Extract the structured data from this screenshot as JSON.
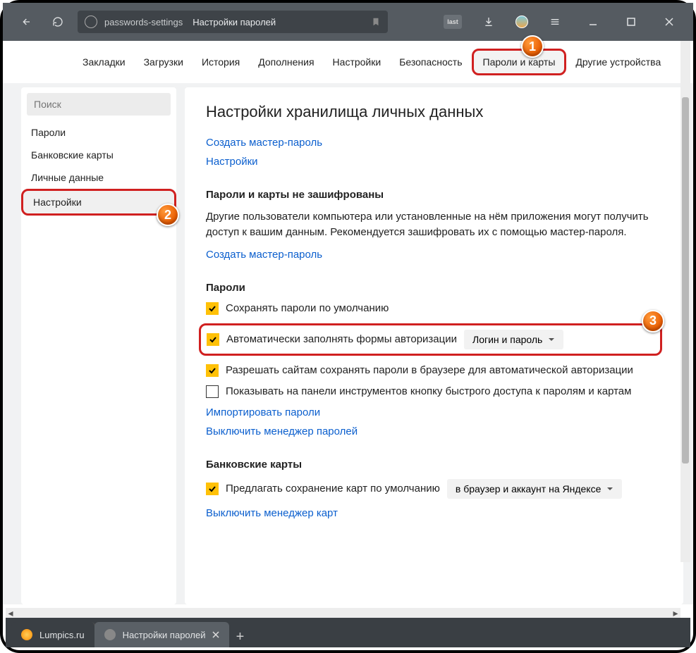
{
  "chrome": {
    "url_slug": "passwords-settings",
    "url_title": "Настройки паролей",
    "ext_badge": "last"
  },
  "topnav": {
    "items": [
      "Закладки",
      "Загрузки",
      "История",
      "Дополнения",
      "Настройки",
      "Безопасность",
      "Пароли и карты",
      "Другие устройства"
    ]
  },
  "sidebar": {
    "search_placeholder": "Поиск",
    "items": [
      "Пароли",
      "Банковские карты",
      "Личные данные",
      "Настройки"
    ]
  },
  "content": {
    "title": "Настройки хранилища личных данных",
    "link_create_master": "Создать мастер-пароль",
    "link_settings": "Настройки",
    "sec_unencrypted_h": "Пароли и карты не зашифрованы",
    "sec_unencrypted_d": "Другие пользователи компьютера или установленные на нём приложения могут получить доступ к вашим данным. Рекомендуется зашифровать их с помощью мастер-пароля.",
    "link_create_master2": "Создать мастер-пароль",
    "sec_passwords_h": "Пароли",
    "chk1": "Сохранять пароли по умолчанию",
    "chk2": "Автоматически заполнять формы авторизации",
    "chk2_dropdown": "Логин и пароль",
    "chk3": "Разрешать сайтам сохранять пароли в браузере для автоматической авторизации",
    "chk4": "Показывать на панели инструментов кнопку быстрого доступа к паролям и картам",
    "link_import": "Импортировать пароли",
    "link_disable_pw": "Выключить менеджер паролей",
    "sec_cards_h": "Банковские карты",
    "chk_cards": "Предлагать сохранение карт по умолчанию",
    "cards_dropdown": "в браузер и аккаунт на Яндексе",
    "link_disable_cards": "Выключить менеджер карт"
  },
  "tabs": {
    "t1": "Lumpics.ru",
    "t2": "Настройки паролей"
  },
  "callouts": {
    "c1": "1",
    "c2": "2",
    "c3": "3"
  }
}
